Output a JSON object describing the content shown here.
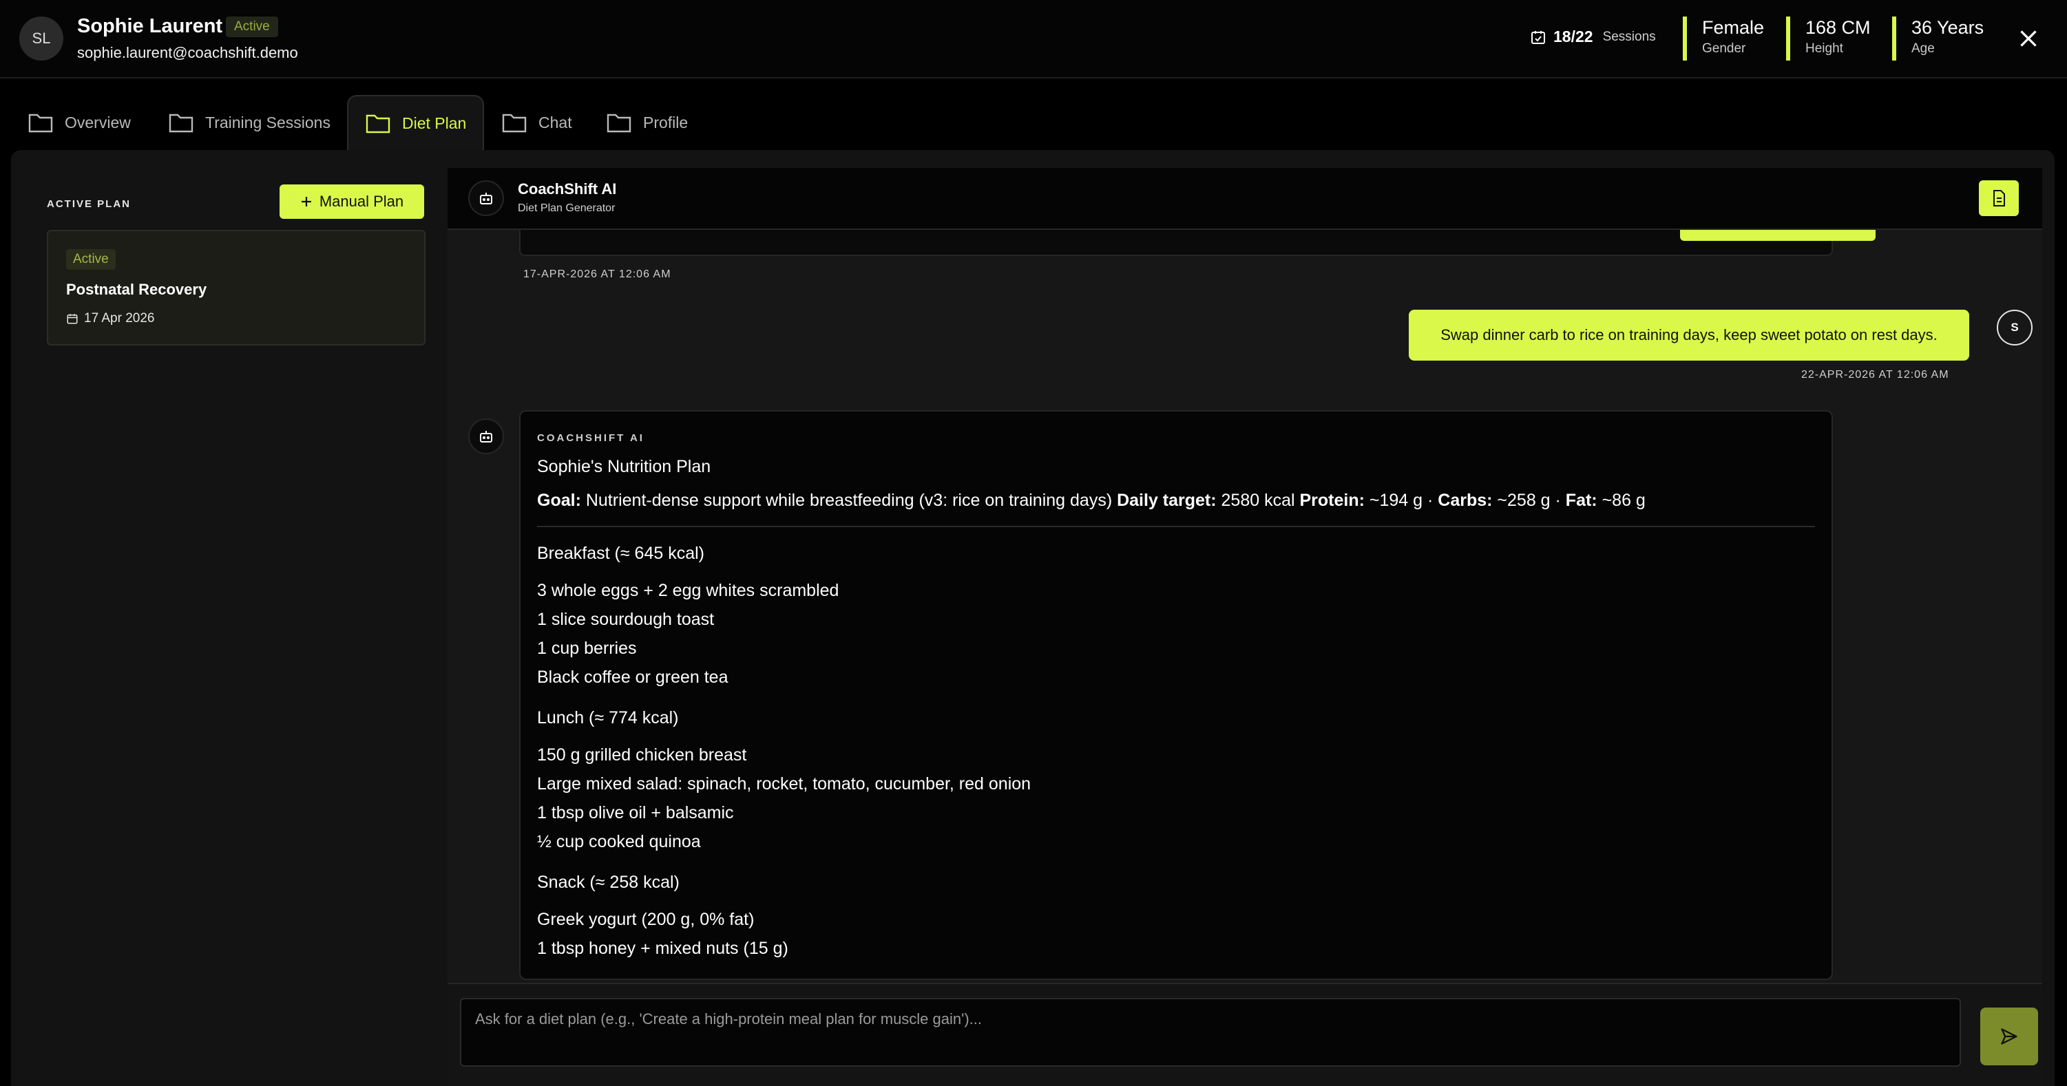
{
  "user": {
    "initials": "SL",
    "name": "Sophie Laurent",
    "status": "Active",
    "email": "sophie.laurent@coachshift.demo"
  },
  "stats": {
    "sessions_count": "18/22",
    "sessions_label": "Sessions",
    "gender_value": "Female",
    "gender_label": "Gender",
    "height_value": "168 CM",
    "height_label": "Height",
    "age_value": "36 Years",
    "age_label": "Age"
  },
  "tabs": [
    {
      "label": "Overview"
    },
    {
      "label": "Training Sessions"
    },
    {
      "label": "Diet Plan"
    },
    {
      "label": "Chat"
    },
    {
      "label": "Profile"
    }
  ],
  "active_tab": "Diet Plan",
  "sidebar": {
    "title": "ACTIVE PLAN",
    "manual_button": "Manual Plan",
    "plan": {
      "badge": "Active",
      "title": "Postnatal Recovery",
      "date": "17 Apr 2026"
    }
  },
  "chat": {
    "header_title": "CoachShift AI",
    "header_subtitle": "Diet Plan Generator",
    "timestamp_prev": "17-APR-2026 AT 12:06 AM",
    "user_message": "Swap dinner carb to rice on training days, keep sweet potato on rest days.",
    "user_avatar": "S",
    "timestamp_user": "22-APR-2026 AT 12:06 AM",
    "ai_author": "COACHSHIFT AI",
    "plan_heading": "Sophie's Nutrition Plan",
    "goal_label": "Goal:",
    "goal_text": " Nutrient-dense support while breastfeeding (v3: rice on training days) ",
    "target_label": "Daily target:",
    "target_text": " 2580 kcal ",
    "protein_label": "Protein:",
    "protein_text": " ~194 g · ",
    "carbs_label": "Carbs:",
    "carbs_text": " ~258 g · ",
    "fat_label": "Fat:",
    "fat_text": " ~86 g",
    "meals": {
      "breakfast": {
        "heading": "Breakfast (≈ 645 kcal)",
        "items": [
          "3 whole eggs + 2 egg whites scrambled",
          "1 slice sourdough toast",
          "1 cup berries",
          "Black coffee or green tea"
        ]
      },
      "lunch": {
        "heading": "Lunch (≈ 774 kcal)",
        "items": [
          "150 g grilled chicken breast",
          "Large mixed salad: spinach, rocket, tomato, cucumber, red onion",
          "1 tbsp olive oil + balsamic",
          "½ cup cooked quinoa"
        ]
      },
      "snack": {
        "heading": "Snack (≈ 258 kcal)",
        "items": [
          "Greek yogurt (200 g, 0% fat)",
          "1 tbsp honey + mixed nuts (15 g)"
        ]
      }
    },
    "input_placeholder": "Ask for a diet plan (e.g., 'Create a high-protein meal plan for muscle gain')..."
  },
  "colors": {
    "accent": "#d9f84a",
    "background": "#000000",
    "panel": "#131313"
  },
  "icons": [
    "calendar-icon",
    "close-icon",
    "folder-icon",
    "plus-icon",
    "robot-icon",
    "document-icon",
    "send-icon"
  ]
}
